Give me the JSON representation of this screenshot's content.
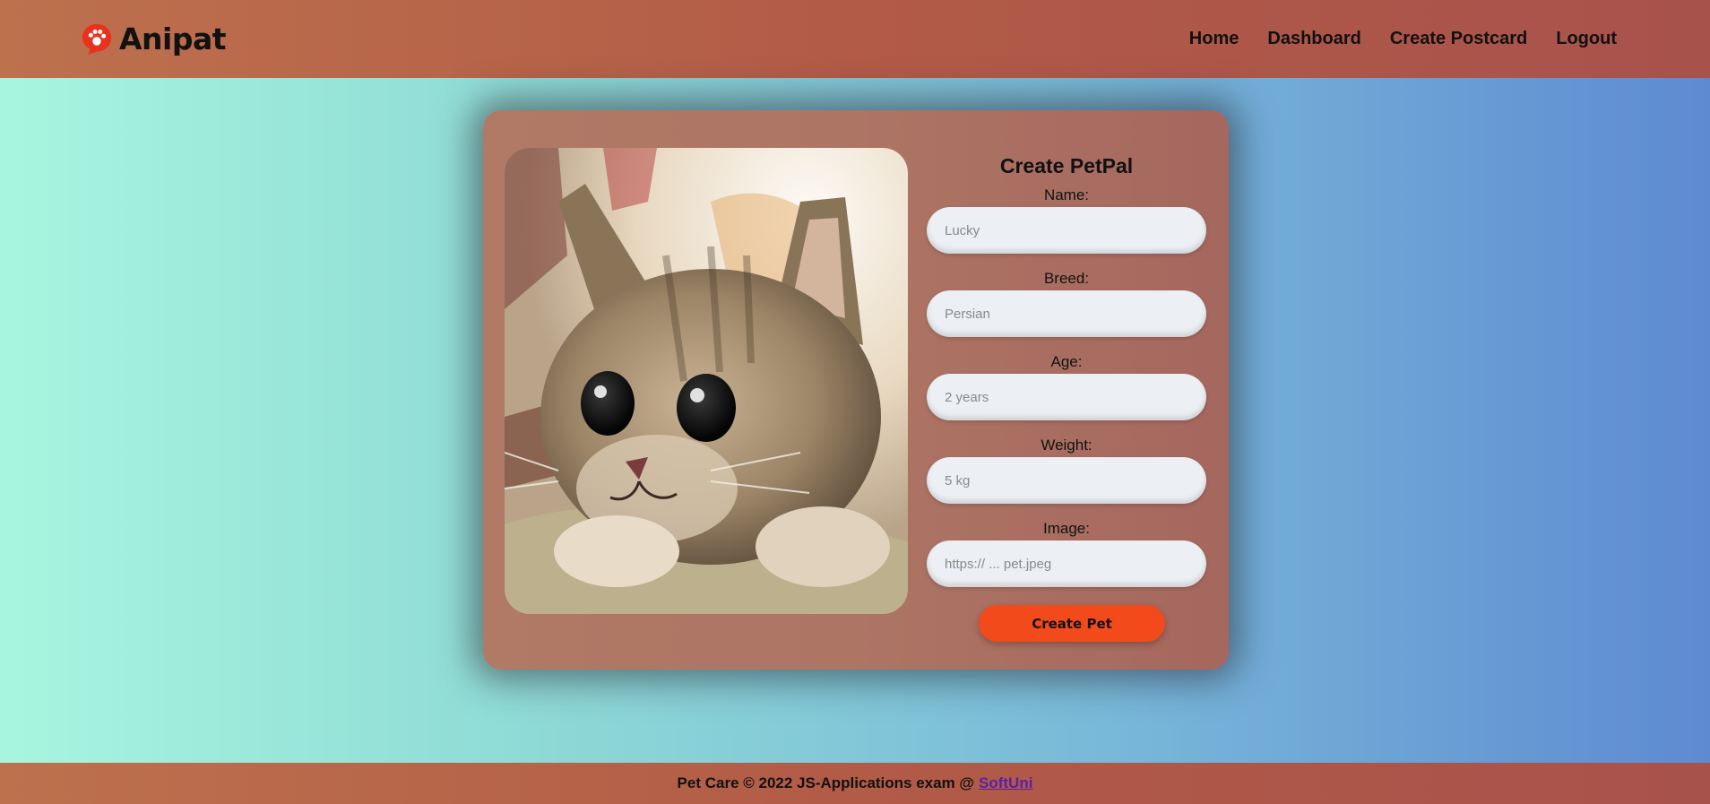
{
  "header": {
    "logo_text": "Anipat",
    "nav": [
      "Home",
      "Dashboard",
      "Create Postcard",
      "Logout"
    ]
  },
  "form": {
    "title": "Create PetPal",
    "fields": [
      {
        "label": "Name:",
        "placeholder": "Lucky",
        "value": ""
      },
      {
        "label": "Breed:",
        "placeholder": "Persian",
        "value": ""
      },
      {
        "label": "Age:",
        "placeholder": "2 years",
        "value": ""
      },
      {
        "label": "Weight:",
        "placeholder": "5 kg",
        "value": ""
      },
      {
        "label": "Image:",
        "placeholder": "https:// ... pet.jpeg",
        "value": ""
      }
    ],
    "submit_label": "Create Pet"
  },
  "footer": {
    "text": "Pet Care © 2022 JS-Applications exam @",
    "link_text": "SoftUni"
  },
  "colors": {
    "header_bg": "#b25b47",
    "accent_button": "#f24a1a",
    "logo_red": "#e8321f",
    "link": "#5a1fa8"
  }
}
